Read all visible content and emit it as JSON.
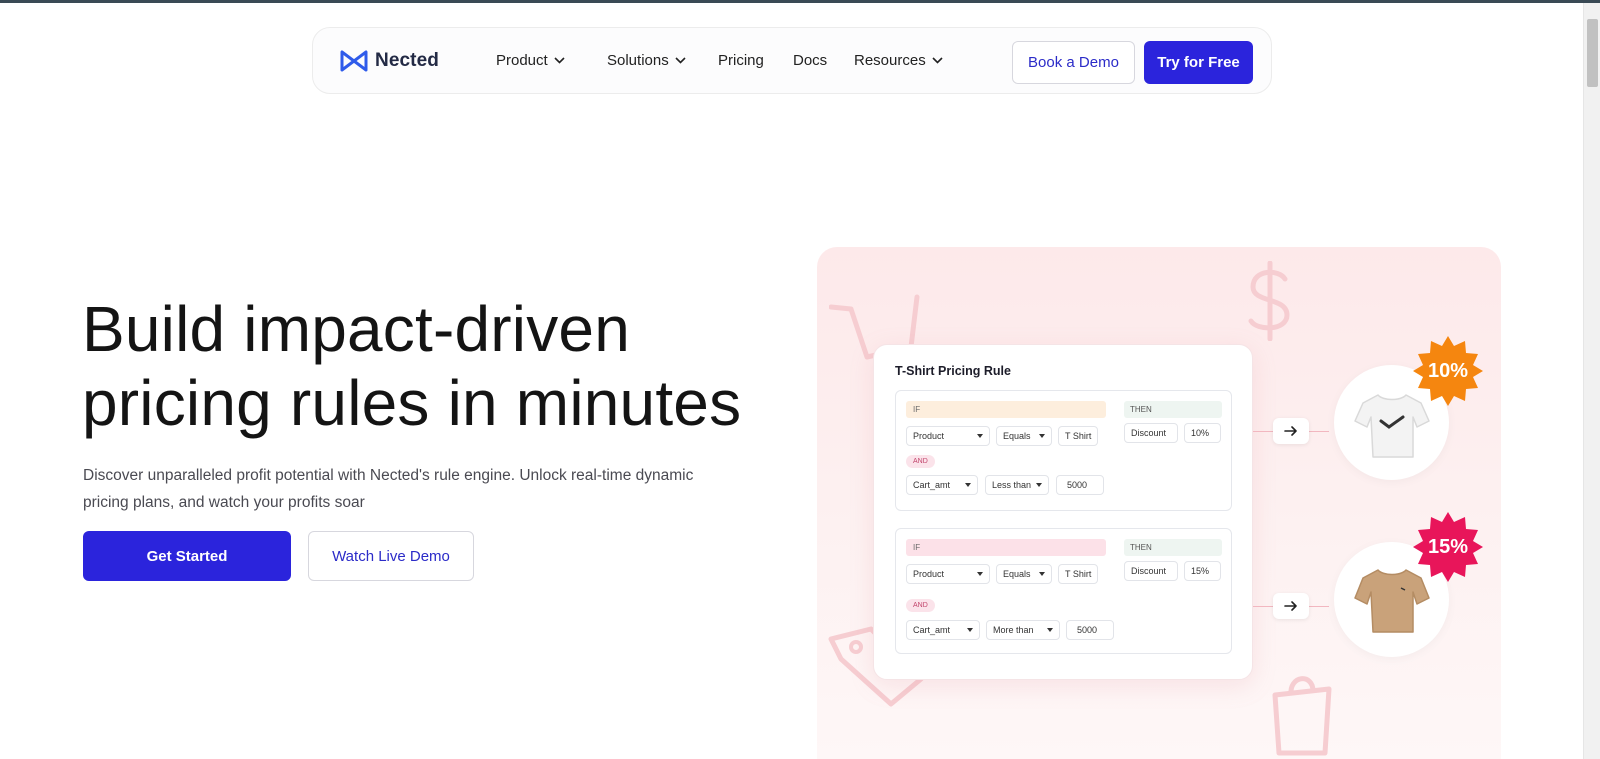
{
  "brand": {
    "name": "Nected",
    "accent": "#2b24dc",
    "logo_color": "#2f5bea"
  },
  "nav": {
    "items": [
      {
        "label": "Product",
        "has_dropdown": true
      },
      {
        "label": "Solutions",
        "has_dropdown": true
      },
      {
        "label": "Pricing",
        "has_dropdown": false
      },
      {
        "label": "Docs",
        "has_dropdown": false
      },
      {
        "label": "Resources",
        "has_dropdown": true
      }
    ],
    "book_demo": "Book a Demo",
    "try_free": "Try for Free"
  },
  "hero": {
    "title_line1": "Build impact-driven",
    "title_line2": "pricing rules in minutes",
    "subtitle": "Discover unparalleled profit potential with Nected's rule engine. Unlock real-time dynamic pricing plans, and watch your profits soar",
    "cta_primary": "Get Started",
    "cta_secondary": "Watch Live Demo"
  },
  "illustration": {
    "card_title": "T-Shirt Pricing Rule",
    "rules": [
      {
        "if_label": "IF",
        "then_label": "THEN",
        "and_label": "AND",
        "cond1": {
          "field": "Product",
          "op": "Equals",
          "value": "T Shirt"
        },
        "cond2": {
          "field": "Cart_amt",
          "op": "Less than",
          "value": "5000"
        },
        "action": {
          "field": "Discount",
          "value": "10%"
        },
        "badge": "10%",
        "badge_color": "#f5860f",
        "product": "white-tshirt-icon"
      },
      {
        "if_label": "IF",
        "then_label": "THEN",
        "and_label": "AND",
        "cond1": {
          "field": "Product",
          "op": "Equals",
          "value": "T Shirt"
        },
        "cond2": {
          "field": "Cart_amt",
          "op": "More than",
          "value": "5000"
        },
        "action": {
          "field": "Discount",
          "value": "15%"
        },
        "badge": "15%",
        "badge_color": "#e8155a",
        "product": "beige-tshirt-icon"
      }
    ]
  }
}
